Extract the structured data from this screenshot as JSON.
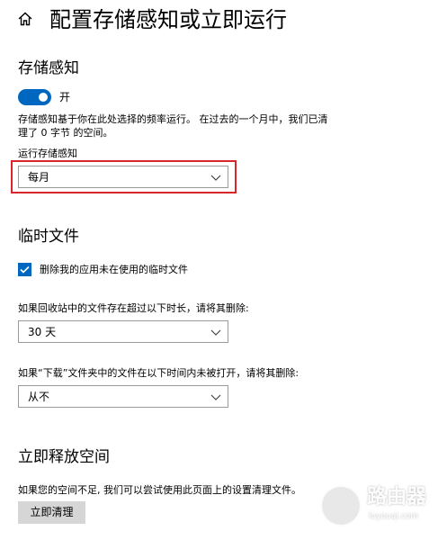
{
  "header": {
    "title": "配置存储感知或立即运行",
    "icon": "home-icon"
  },
  "storage_sense": {
    "heading": "存储感知",
    "toggle": {
      "state": "on",
      "label": "开"
    },
    "description_line1": "存储感知基于你在此处选择的频率运行。 在过去的一个月中，我们已清",
    "description_line2": "理了 0 字节 的空间。",
    "run_label": "运行存储感知",
    "run_value": "每月"
  },
  "temp_files": {
    "heading": "临时文件",
    "checkbox": {
      "checked": true,
      "label": "删除我的应用未在使用的临时文件"
    },
    "recycle_label": "如果回收站中的文件存在超过以下时长，请将其删除:",
    "recycle_value": "30 天",
    "downloads_label": "如果“下载”文件夹中的文件在以下时间内未被打开，请将其删除:",
    "downloads_value": "从不"
  },
  "free_space": {
    "heading": "立即释放空间",
    "description": "如果您的空间不足, 我们可以尝试使用此页面上的设置清理文件。",
    "button_label": "立即清理"
  },
  "watermark": {
    "text_main": "路由器",
    "text_sub": "luyouqi.com"
  },
  "colors": {
    "accent": "#0067c0",
    "highlight": "#d9262d",
    "button_bg": "#d6d6d6"
  }
}
